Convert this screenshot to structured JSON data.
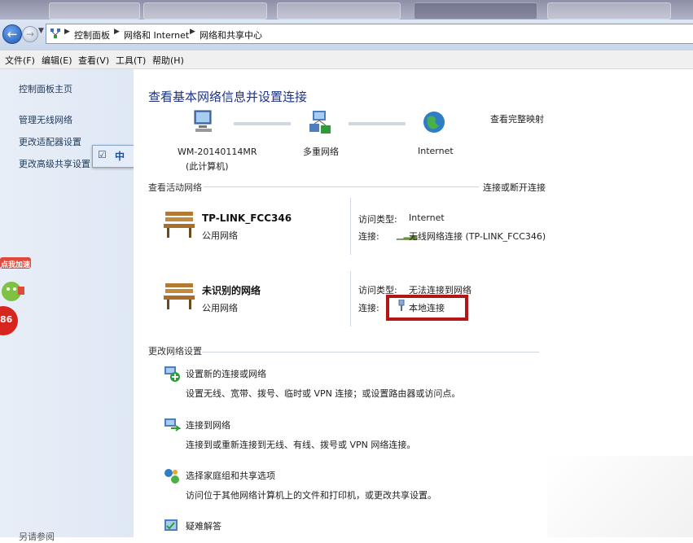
{
  "address": {
    "crumbs": [
      "控制面板",
      "网络和 Internet",
      "网络和共享中心"
    ]
  },
  "menu": [
    "文件(F)",
    "编辑(E)",
    "查看(V)",
    "工具(T)",
    "帮助(H)"
  ],
  "sidebar": {
    "links": [
      "控制面板主页",
      "管理无线网络",
      "更改适配器设置",
      "更改高级共享设置"
    ],
    "bottom": "另请参阅"
  },
  "ime": {
    "mode": "中"
  },
  "mascot": {
    "badge": "点我加速",
    "number": "86"
  },
  "main": {
    "title": "查看基本网络信息并设置连接",
    "view_full_map": "查看完整映射",
    "map": {
      "computer_name": "WM-20140114MR",
      "computer_sub": "(此计算机)",
      "middle": "多重网络",
      "internet": "Internet"
    },
    "active_label": "查看活动网络",
    "connect_disconnect": "连接或断开连接",
    "networks": [
      {
        "name": "TP-LINK_FCC346",
        "type": "公用网络",
        "access_label": "访问类型:",
        "access": "Internet",
        "conn_label": "连接:",
        "conn": "无线网络连接 (TP-LINK_FCC346)"
      },
      {
        "name": "未识别的网络",
        "type": "公用网络",
        "access_label": "访问类型:",
        "access": "无法连接到网络",
        "conn_label": "连接:",
        "conn": "本地连接"
      }
    ],
    "change_label": "更改网络设置",
    "tasks": [
      {
        "title": "设置新的连接或网络",
        "desc": "设置无线、宽带、拨号、临时或 VPN 连接；或设置路由器或访问点。"
      },
      {
        "title": "连接到网络",
        "desc": "连接到或重新连接到无线、有线、拨号或 VPN 网络连接。"
      },
      {
        "title": "选择家庭组和共享选项",
        "desc": "访问位于其他网络计算机上的文件和打印机，或更改共享设置。"
      },
      {
        "title": "疑难解答",
        "desc": ""
      }
    ]
  },
  "colors": {
    "link": "#1a5fb4",
    "heading": "#1e3287",
    "highlight": "#b31616"
  }
}
